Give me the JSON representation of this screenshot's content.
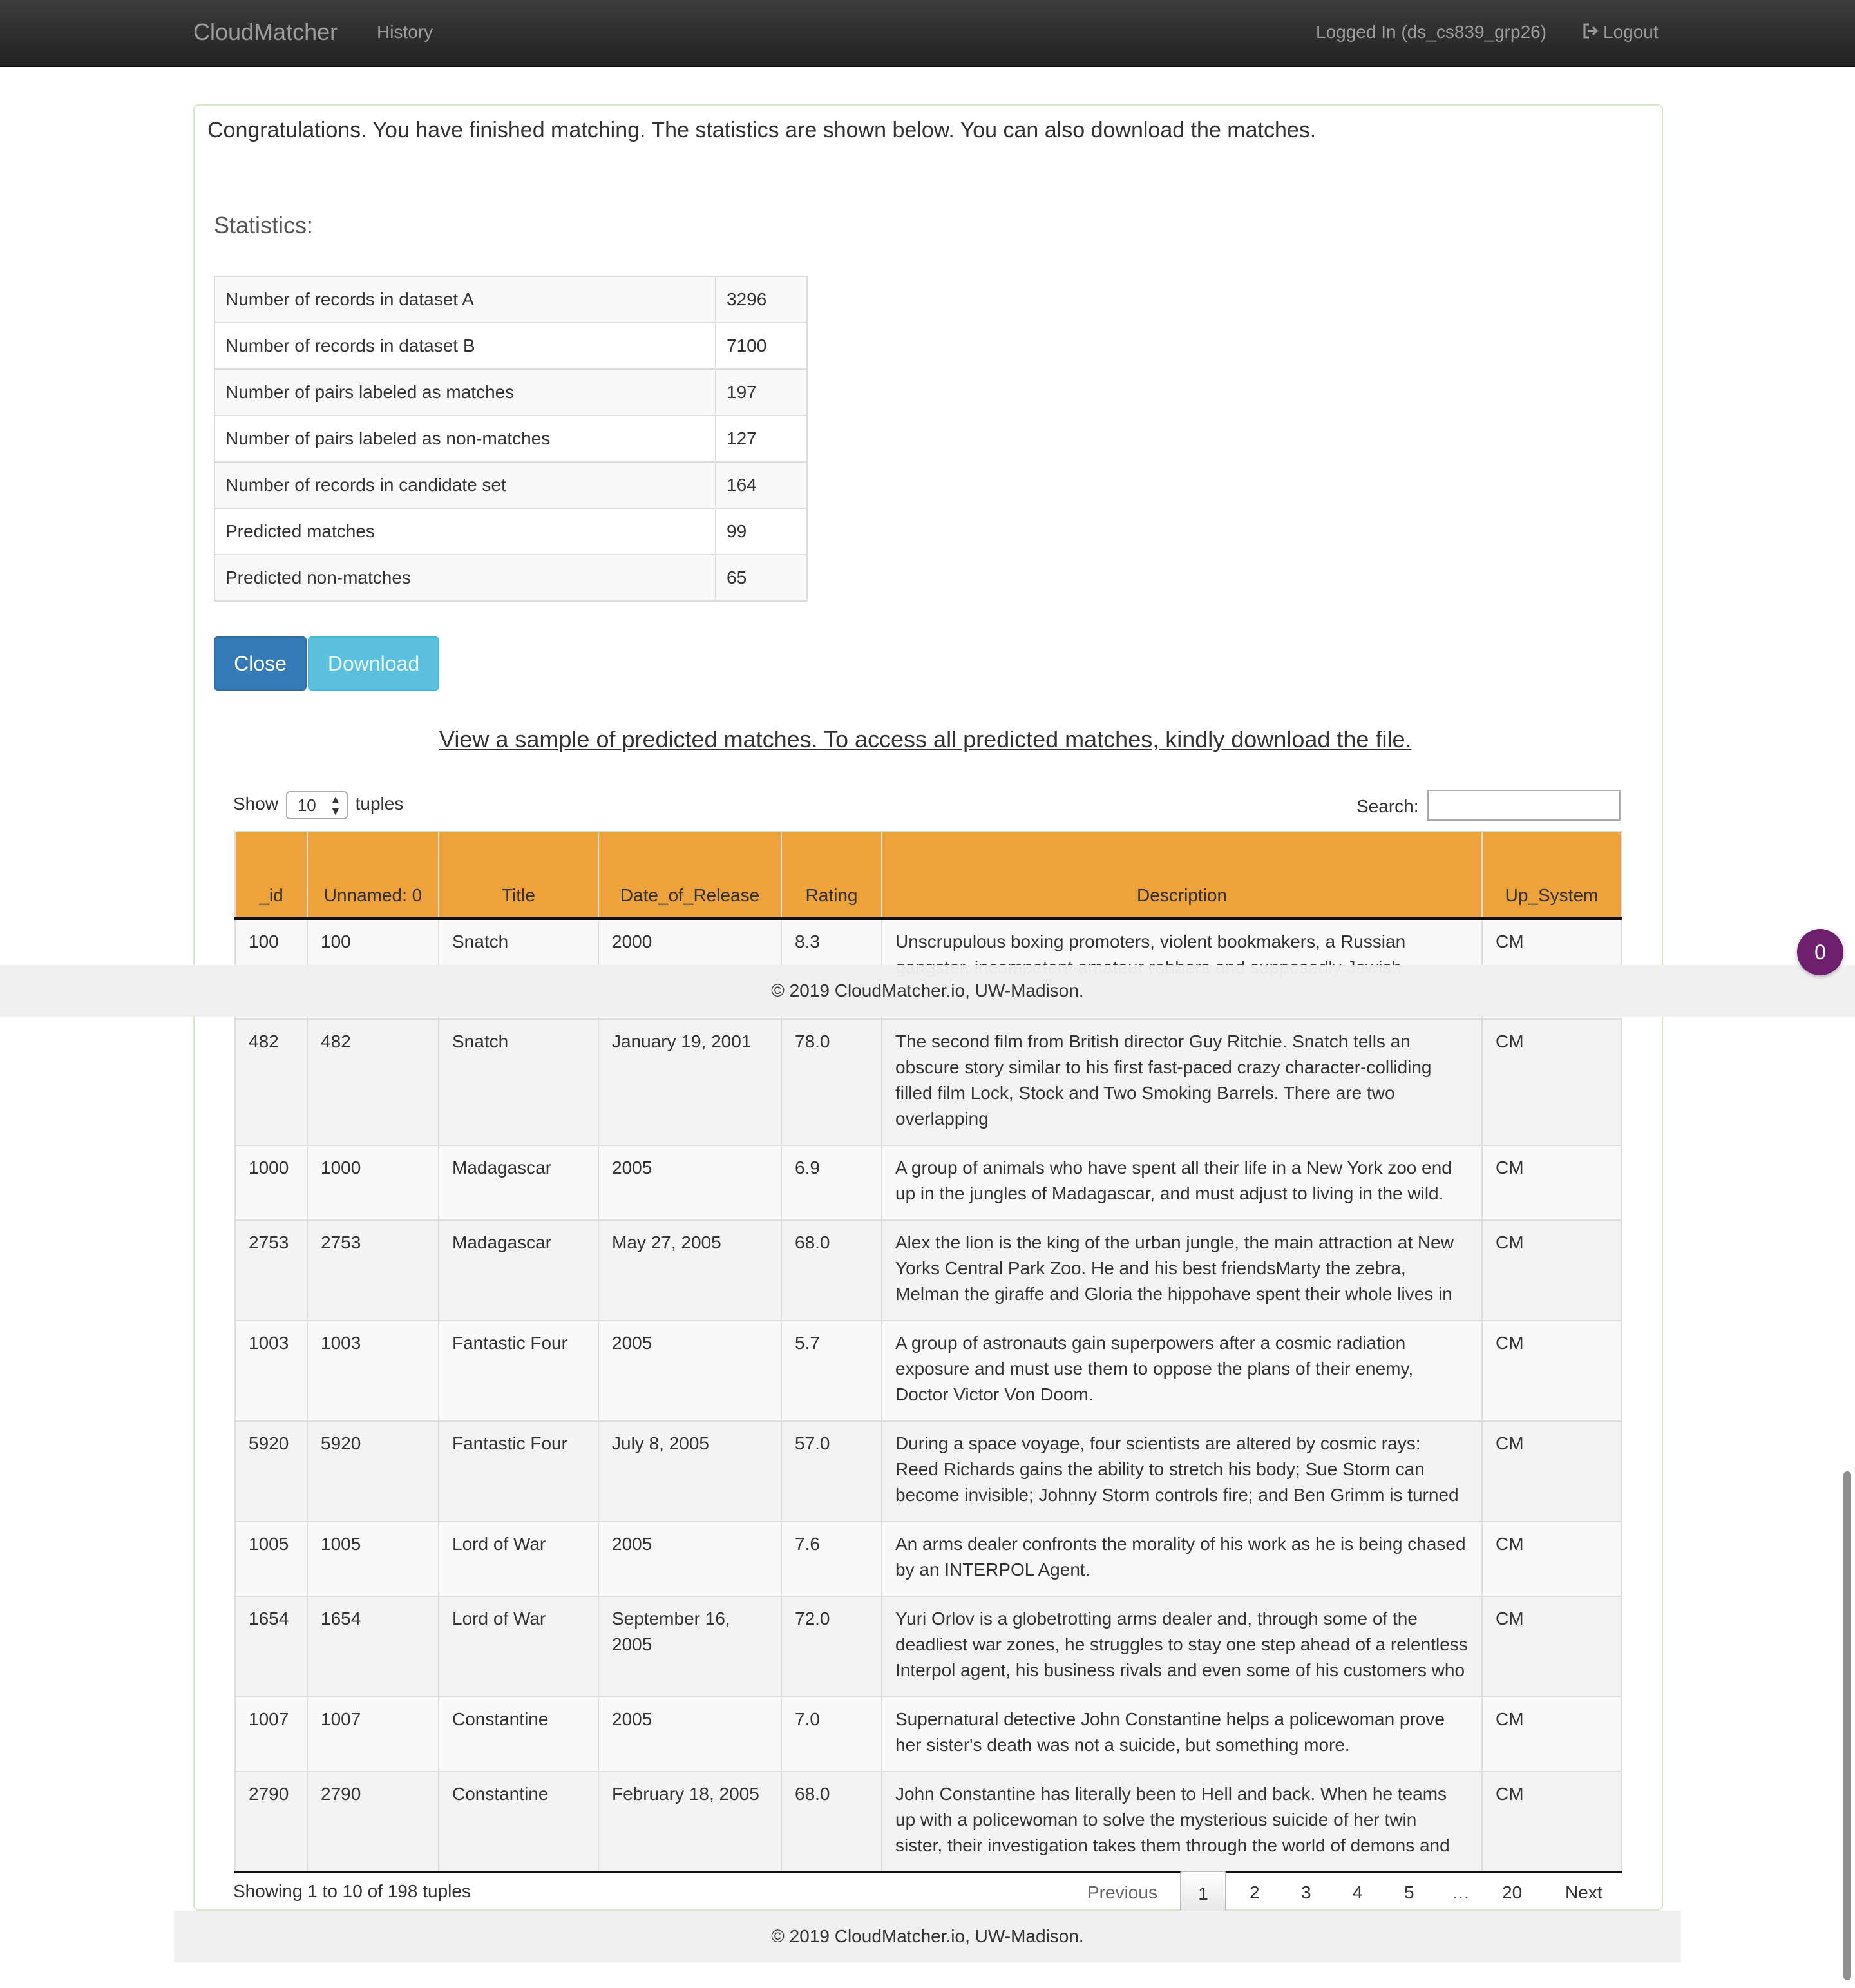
{
  "navbar": {
    "brand": "CloudMatcher",
    "history": "History",
    "user": "Logged In (ds_cs839_grp26)",
    "logout": "Logout"
  },
  "panel": {
    "message": "Congratulations. You have finished matching. The statistics are shown below. You can also download the matches.",
    "stats_heading": "Statistics:",
    "stats": [
      {
        "label": "Number of records in dataset A",
        "value": "3296"
      },
      {
        "label": "Number of records in dataset B",
        "value": "7100"
      },
      {
        "label": "Number of pairs labeled as matches",
        "value": "197"
      },
      {
        "label": "Number of pairs labeled as non-matches",
        "value": "127"
      },
      {
        "label": "Number of records in candidate set",
        "value": "164"
      },
      {
        "label": "Predicted matches",
        "value": "99"
      },
      {
        "label": "Predicted non-matches",
        "value": "65"
      }
    ],
    "close_label": "Close",
    "download_label": "Download",
    "sample_link": "View a sample of predicted matches. To access all predicted matches, kindly download the file."
  },
  "table_controls": {
    "show_prefix": "Show",
    "show_value": "10",
    "show_suffix": "tuples",
    "search_label": "Search:",
    "search_value": ""
  },
  "table": {
    "columns": [
      "_id",
      "Unnamed: 0",
      "Title",
      "Date_of_Release",
      "Rating",
      "Description",
      "Up_System"
    ],
    "rows": [
      {
        "id": "100",
        "unnamed": "100",
        "title": "Snatch",
        "date": "2000",
        "rating": "8.3",
        "description": "Unscrupulous boxing promoters, violent bookmakers, a Russian gangster, incompetent amateur robbers and supposedly Jewish",
        "system": "CM"
      },
      {
        "id": "482",
        "unnamed": "482",
        "title": "Snatch",
        "date": "January 19, 2001",
        "rating": "78.0",
        "description": "The second film from British director Guy Ritchie. Snatch tells an obscure story similar to his first fast-paced crazy character-colliding filled film Lock, Stock and Two Smoking Barrels. There are two overlapping",
        "system": "CM"
      },
      {
        "id": "1000",
        "unnamed": "1000",
        "title": "Madagascar",
        "date": "2005",
        "rating": "6.9",
        "description": "A group of animals who have spent all their life in a New York zoo end up in the jungles of Madagascar, and must adjust to living in the wild.",
        "system": "CM"
      },
      {
        "id": "2753",
        "unnamed": "2753",
        "title": "Madagascar",
        "date": "May 27, 2005",
        "rating": "68.0",
        "description": "Alex the lion is the king of the urban jungle, the main attraction at New Yorks Central Park Zoo. He and his best friendsMarty the zebra, Melman the giraffe and Gloria the hippohave spent their whole lives in",
        "system": "CM"
      },
      {
        "id": "1003",
        "unnamed": "1003",
        "title": "Fantastic Four",
        "date": "2005",
        "rating": "5.7",
        "description": "A group of astronauts gain superpowers after a cosmic radiation exposure and must use them to oppose the plans of their enemy, Doctor Victor Von Doom.",
        "system": "CM"
      },
      {
        "id": "5920",
        "unnamed": "5920",
        "title": "Fantastic Four",
        "date": "July 8, 2005",
        "rating": "57.0",
        "description": "During a space voyage, four scientists are altered by cosmic rays: Reed Richards gains the ability to stretch his body; Sue Storm can become invisible; Johnny Storm controls fire; and Ben Grimm is turned into a",
        "system": "CM"
      },
      {
        "id": "1005",
        "unnamed": "1005",
        "title": "Lord of War",
        "date": "2005",
        "rating": "7.6",
        "description": "An arms dealer confronts the morality of his work as he is being chased by an INTERPOL Agent.",
        "system": "CM"
      },
      {
        "id": "1654",
        "unnamed": "1654",
        "title": "Lord of War",
        "date": "September 16, 2005",
        "rating": "72.0",
        "description": "Yuri Orlov is a globetrotting arms dealer and, through some of the deadliest war zones, he struggles to stay one step ahead of a relentless Interpol agent, his business rivals and even some of his customers who",
        "system": "CM"
      },
      {
        "id": "1007",
        "unnamed": "1007",
        "title": "Constantine",
        "date": "2005",
        "rating": "7.0",
        "description": "Supernatural detective John Constantine helps a policewoman prove her sister's death was not a suicide, but something more.",
        "system": "CM"
      },
      {
        "id": "2790",
        "unnamed": "2790",
        "title": "Constantine",
        "date": "February 18, 2005",
        "rating": "68.0",
        "description": "John Constantine has literally been to Hell and back. When he teams up with a policewoman to solve the mysterious suicide of her twin sister, their investigation takes them through the world of demons and angels",
        "system": "CM"
      }
    ]
  },
  "pagination": {
    "info": "Showing 1 to 10 of 198 tuples",
    "previous": "Previous",
    "pages": [
      "1",
      "2",
      "3",
      "4",
      "5"
    ],
    "ellipsis": "…",
    "last_page": "20",
    "next": "Next"
  },
  "footer": {
    "text": "© 2019 CloudMatcher.io, UW-Madison."
  },
  "badge": {
    "count": "0"
  },
  "colors": {
    "header_row": "#eea23b",
    "navbar": "#222222",
    "primary_button": "#337ab7",
    "info_button": "#5bc0de",
    "badge": "#6e1f6e"
  }
}
